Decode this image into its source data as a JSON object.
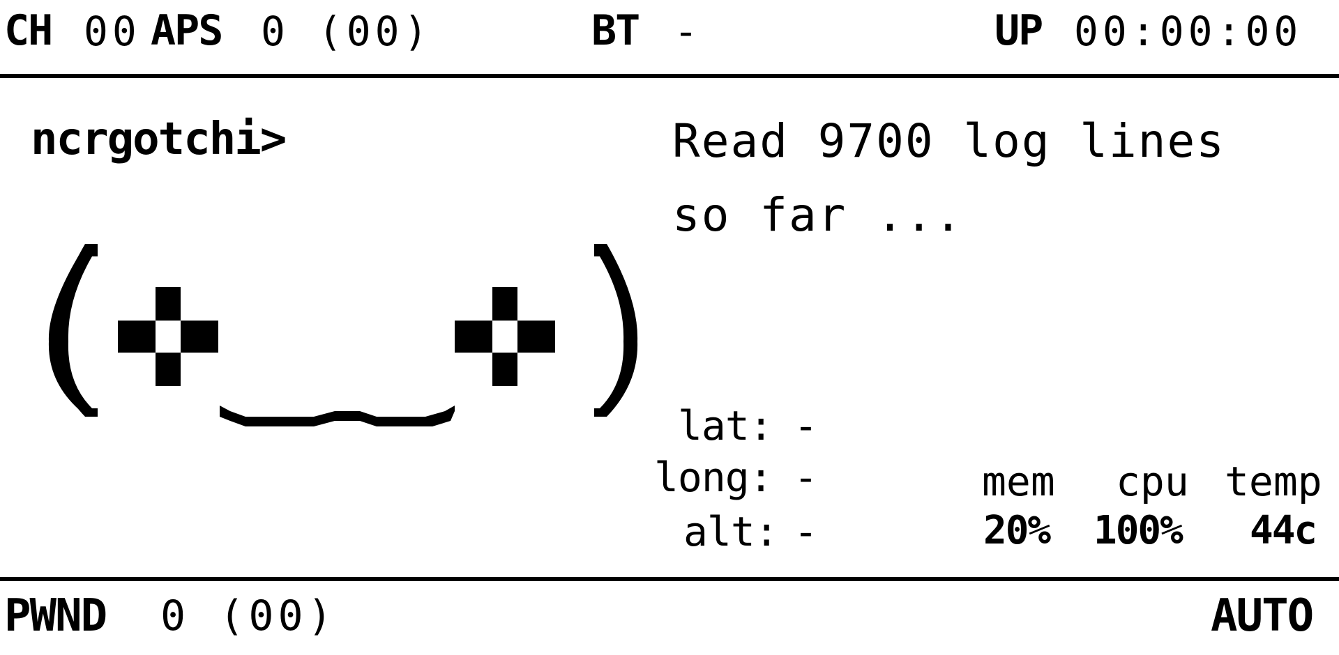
{
  "top_bar": {
    "channel_label": "CH",
    "channel_value": "00",
    "aps_label": "APS",
    "aps_value": "0 (00)",
    "bt_label": "BT",
    "bt_value": "-",
    "uptime_label": "UP",
    "uptime_value": "00:00:00"
  },
  "name": "ncrgotchi>",
  "status": {
    "line1": "Read 9700 log lines",
    "line2": "so far ..."
  },
  "face": {
    "icon": "face-icon",
    "text": "(+__+)"
  },
  "gps": {
    "lat_label": "lat:",
    "lat_value": "-",
    "long_label": "long:",
    "long_value": "-",
    "alt_label": "alt:",
    "alt_value": "-"
  },
  "system": {
    "mem_label": "mem",
    "mem_value": "20%",
    "cpu_label": "cpu",
    "cpu_value": "100%",
    "temp_label": "temp",
    "temp_value": "44c"
  },
  "bottom_bar": {
    "pwnd_label": "PWND",
    "pwnd_value": "0 (00)",
    "mode": "AUTO"
  }
}
